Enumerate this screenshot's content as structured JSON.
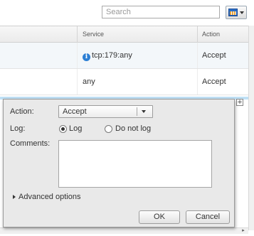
{
  "toolbar": {
    "search_placeholder": "Search",
    "view_button_icon": "grid-view-icon"
  },
  "table": {
    "columns": [
      "",
      "Service",
      "Action"
    ],
    "rows": [
      {
        "service": "tcp:179:any",
        "action": "Accept",
        "service_icon": "info-icon"
      },
      {
        "service": "any",
        "action": "Accept"
      }
    ]
  },
  "dialog": {
    "action_label": "Action:",
    "action_value": "Accept",
    "log_label": "Log:",
    "log_option": "Log",
    "do_not_log_option": "Do not log",
    "log_selected": "Log",
    "comments_label": "Comments:",
    "comments_value": "",
    "advanced_label": "Advanced options",
    "ok_label": "OK",
    "cancel_label": "Cancel"
  },
  "colors": {
    "info_icon": "#2c7fd4",
    "selected_row": "#bfe0f5",
    "dialog_bg": "#e9e9e9"
  }
}
